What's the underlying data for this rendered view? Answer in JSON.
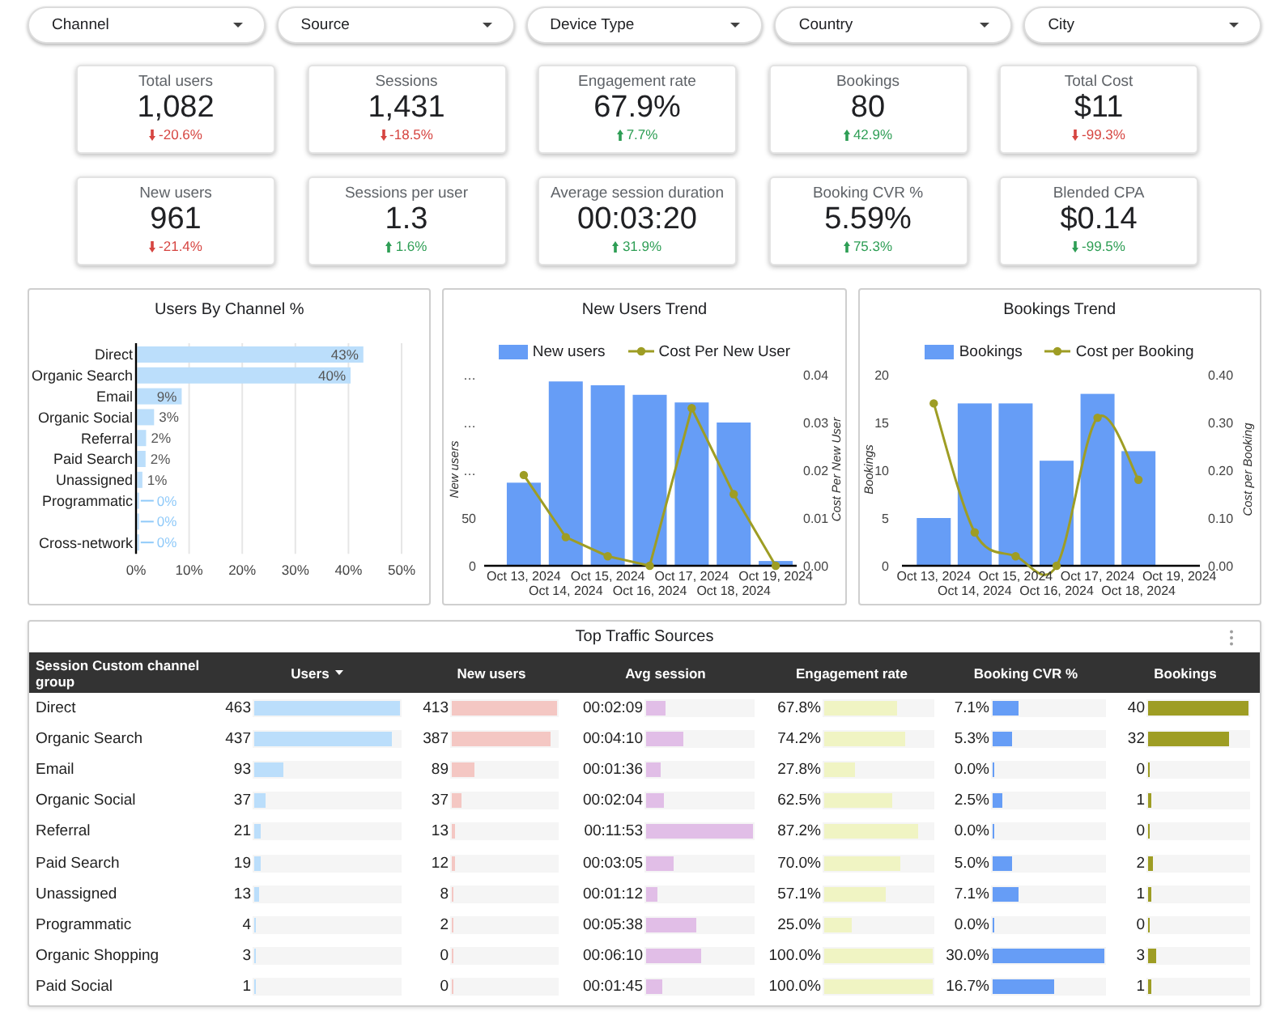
{
  "filters": [
    {
      "label": "Channel"
    },
    {
      "label": "Source"
    },
    {
      "label": "Device Type"
    },
    {
      "label": "Country"
    },
    {
      "label": "City"
    }
  ],
  "kpi_rows": [
    [
      {
        "label": "Total users",
        "value": "1,082",
        "delta": "-20.6%",
        "trend_up": false,
        "favorable": false
      },
      {
        "label": "Sessions",
        "value": "1,431",
        "delta": "-18.5%",
        "trend_up": false,
        "favorable": false
      },
      {
        "label": "Engagement rate",
        "value": "67.9%",
        "delta": "7.7%",
        "trend_up": true,
        "favorable": true
      },
      {
        "label": "Bookings",
        "value": "80",
        "delta": "42.9%",
        "trend_up": true,
        "favorable": true
      },
      {
        "label": "Total Cost",
        "value": "$11",
        "delta": "-99.3%",
        "trend_up": false,
        "favorable": false
      }
    ],
    [
      {
        "label": "New users",
        "value": "961",
        "delta": "-21.4%",
        "trend_up": false,
        "favorable": false
      },
      {
        "label": "Sessions per user",
        "value": "1.3",
        "delta": "1.6%",
        "trend_up": true,
        "favorable": true
      },
      {
        "label": "Average session duration",
        "value": "00:03:20",
        "delta": "31.9%",
        "trend_up": true,
        "favorable": true
      },
      {
        "label": "Booking CVR %",
        "value": "5.59%",
        "delta": "75.3%",
        "trend_up": true,
        "favorable": true
      },
      {
        "label": "Blended CPA",
        "value": "$0.14",
        "delta": "-99.5%",
        "trend_up": false,
        "favorable": true
      }
    ]
  ],
  "charts": [
    {
      "title": "Users By Channel %",
      "chart_data": {
        "type": "bar",
        "orientation": "horizontal",
        "grid": true,
        "categories": [
          "Direct",
          "Organic Search",
          "Email",
          "Organic Social",
          "Referral",
          "Paid Search",
          "Unassigned",
          "Programmatic",
          null,
          "Cross-network"
        ],
        "values": [
          42.8,
          40.4,
          8.6,
          3.4,
          1.9,
          1.8,
          1.2,
          0.4,
          0.3,
          0.1
        ],
        "value_labels": [
          "43%",
          "40%",
          "9%",
          "3%",
          "2%",
          "2%",
          "1%",
          "0%",
          "0%",
          "0%"
        ],
        "xlim": [
          0,
          50
        ],
        "xticks": [
          {
            "value": 0,
            "label": "0%"
          },
          {
            "value": 10,
            "label": "10%"
          },
          {
            "value": 20,
            "label": "20%"
          },
          {
            "value": 30,
            "label": "30%"
          },
          {
            "value": 40,
            "label": "40%"
          },
          {
            "value": 50,
            "label": "50%"
          }
        ]
      }
    },
    {
      "title": "New Users Trend",
      "chart_data": {
        "type": "bar",
        "orientation": "vertical",
        "legend": "top",
        "categories": [
          "Oct 13, 2024",
          "Oct 14, 2024",
          "Oct 15, 2024",
          "Oct 16, 2024",
          "Oct 17, 2024",
          "Oct 18, 2024",
          "Oct 19, 2024"
        ],
        "series": [
          {
            "name": "New users",
            "type": "bar",
            "color": "#669df6",
            "values": [
              87,
              193,
              189,
              179,
              171,
              150,
              5
            ]
          },
          {
            "name": "Cost Per New User",
            "type": "line",
            "axis": "y2",
            "marker": "circle",
            "color": "#9e9d24",
            "values": [
              0.019,
              0.006,
              0.002,
              0,
              0.033,
              0.015,
              0
            ]
          }
        ],
        "ylabel": "New users",
        "ylim": [
          0,
          200
        ],
        "yticks": [
          {
            "value": 0,
            "label": "0"
          },
          {
            "value": 50,
            "label": "50"
          },
          {
            "value": 100,
            "label": "…"
          },
          {
            "value": 150,
            "label": "…"
          },
          {
            "value": 200,
            "label": "…"
          }
        ],
        "y2label": "Cost Per New User",
        "y2lim": [
          0,
          0.04
        ],
        "y2ticks": [
          {
            "value": 0,
            "label": "0.00"
          },
          {
            "value": 0.01,
            "label": "0.01"
          },
          {
            "value": 0.02,
            "label": "0.02"
          },
          {
            "value": 0.03,
            "label": "0.03"
          },
          {
            "value": 0.04,
            "label": "0.04"
          }
        ]
      }
    },
    {
      "title": "Bookings Trend",
      "chart_data": {
        "type": "bar",
        "orientation": "vertical",
        "legend": "top",
        "categories": [
          "Oct 13, 2024",
          "Oct 14, 2024",
          "Oct 15, 2024",
          "Oct 16, 2024",
          "Oct 17, 2024",
          "Oct 18, 2024",
          "Oct 19, 2024"
        ],
        "series": [
          {
            "name": "Bookings",
            "type": "bar",
            "color": "#669df6",
            "values": [
              5,
              17,
              17,
              11,
              18,
              12,
              0
            ]
          },
          {
            "name": "Cost per Booking",
            "type": "line",
            "axis": "y2",
            "marker": "circle",
            "color": "#9e9d24",
            "values": [
              0.34,
              0.07,
              0.02,
              0,
              0.31,
              0.18,
              null
            ]
          }
        ],
        "ylabel": "Bookings",
        "ylim": [
          0,
          20
        ],
        "yticks": [
          {
            "value": 0,
            "label": "0"
          },
          {
            "value": 5,
            "label": "5"
          },
          {
            "value": 10,
            "label": "10"
          },
          {
            "value": 15,
            "label": "15"
          },
          {
            "value": 20,
            "label": "20"
          }
        ],
        "y2label": "Cost per Booking",
        "y2lim": [
          0,
          0.4
        ],
        "y2ticks": [
          {
            "value": 0,
            "label": "0.00"
          },
          {
            "value": 0.1,
            "label": "0.10"
          },
          {
            "value": 0.2,
            "label": "0.20"
          },
          {
            "value": 0.3,
            "label": "0.30"
          },
          {
            "value": 0.4,
            "label": "0.40"
          }
        ]
      }
    }
  ],
  "table": {
    "title": "Top Traffic Sources",
    "columns": [
      {
        "label": "Session Custom channel group",
        "sorted": false
      },
      {
        "label": "Users",
        "sorted": true
      },
      {
        "label": "New users",
        "sorted": false
      },
      {
        "label": "Avg session",
        "sorted": false
      },
      {
        "label": "Engagement rate",
        "sorted": false
      },
      {
        "label": "Booking CVR %",
        "sorted": false
      },
      {
        "label": "Bookings",
        "sorted": false
      }
    ],
    "rows": [
      {
        "channel": "Direct",
        "cells": [
          {
            "text": "463",
            "level": 1
          },
          {
            "text": "413",
            "level": 1
          },
          {
            "text": "00:02:09",
            "level": 0.181
          },
          {
            "text": "67.8%",
            "level": 0.678
          },
          {
            "text": "7.1%",
            "level": 0.237
          },
          {
            "text": "40",
            "level": 1
          }
        ]
      },
      {
        "channel": "Organic Search",
        "cells": [
          {
            "text": "437",
            "level": 0.944
          },
          {
            "text": "387",
            "level": 0.937
          },
          {
            "text": "00:04:10",
            "level": 0.351
          },
          {
            "text": "74.2%",
            "level": 0.742
          },
          {
            "text": "5.3%",
            "level": 0.177
          },
          {
            "text": "32",
            "level": 0.8
          }
        ]
      },
      {
        "channel": "Email",
        "cells": [
          {
            "text": "93",
            "level": 0.201
          },
          {
            "text": "89",
            "level": 0.215
          },
          {
            "text": "00:01:36",
            "level": 0.135
          },
          {
            "text": "27.8%",
            "level": 0.278
          },
          {
            "text": "0.0%",
            "level": 0
          },
          {
            "text": "0",
            "level": 0
          }
        ]
      },
      {
        "channel": "Organic Social",
        "cells": [
          {
            "text": "37",
            "level": 0.08
          },
          {
            "text": "37",
            "level": 0.09
          },
          {
            "text": "00:02:04",
            "level": 0.174
          },
          {
            "text": "62.5%",
            "level": 0.625
          },
          {
            "text": "2.5%",
            "level": 0.083
          },
          {
            "text": "1",
            "level": 0.025
          }
        ]
      },
      {
        "channel": "Referral",
        "cells": [
          {
            "text": "21",
            "level": 0.045
          },
          {
            "text": "13",
            "level": 0.031
          },
          {
            "text": "00:11:53",
            "level": 1
          },
          {
            "text": "87.2%",
            "level": 0.872
          },
          {
            "text": "0.0%",
            "level": 0
          },
          {
            "text": "0",
            "level": 0
          }
        ]
      },
      {
        "channel": "Paid Search",
        "cells": [
          {
            "text": "19",
            "level": 0.041
          },
          {
            "text": "12",
            "level": 0.029
          },
          {
            "text": "00:03:05",
            "level": 0.259
          },
          {
            "text": "70.0%",
            "level": 0.7
          },
          {
            "text": "5.0%",
            "level": 0.167
          },
          {
            "text": "2",
            "level": 0.05
          }
        ]
      },
      {
        "channel": "Unassigned",
        "cells": [
          {
            "text": "13",
            "level": 0.028
          },
          {
            "text": "8",
            "level": 0.019
          },
          {
            "text": "00:01:12",
            "level": 0.101
          },
          {
            "text": "57.1%",
            "level": 0.571
          },
          {
            "text": "7.1%",
            "level": 0.237
          },
          {
            "text": "1",
            "level": 0.025
          }
        ]
      },
      {
        "channel": "Programmatic",
        "cells": [
          {
            "text": "4",
            "level": 0.009
          },
          {
            "text": "2",
            "level": 0.005
          },
          {
            "text": "00:05:38",
            "level": 0.474
          },
          {
            "text": "25.0%",
            "level": 0.25
          },
          {
            "text": "0.0%",
            "level": 0
          },
          {
            "text": "0",
            "level": 0
          }
        ]
      },
      {
        "channel": "Organic Shopping",
        "cells": [
          {
            "text": "3",
            "level": 0.006
          },
          {
            "text": "0",
            "level": 0
          },
          {
            "text": "00:06:10",
            "level": 0.519
          },
          {
            "text": "100.0%",
            "level": 1
          },
          {
            "text": "30.0%",
            "level": 1
          },
          {
            "text": "3",
            "level": 0.075
          }
        ]
      },
      {
        "channel": "Paid Social",
        "cells": [
          {
            "text": "1",
            "level": 0.002
          },
          {
            "text": "0",
            "level": 0
          },
          {
            "text": "00:01:45",
            "level": 0.147
          },
          {
            "text": "100.0%",
            "level": 1
          },
          {
            "text": "16.7%",
            "level": 0.557
          },
          {
            "text": "1",
            "level": 0.025
          }
        ]
      }
    ]
  }
}
